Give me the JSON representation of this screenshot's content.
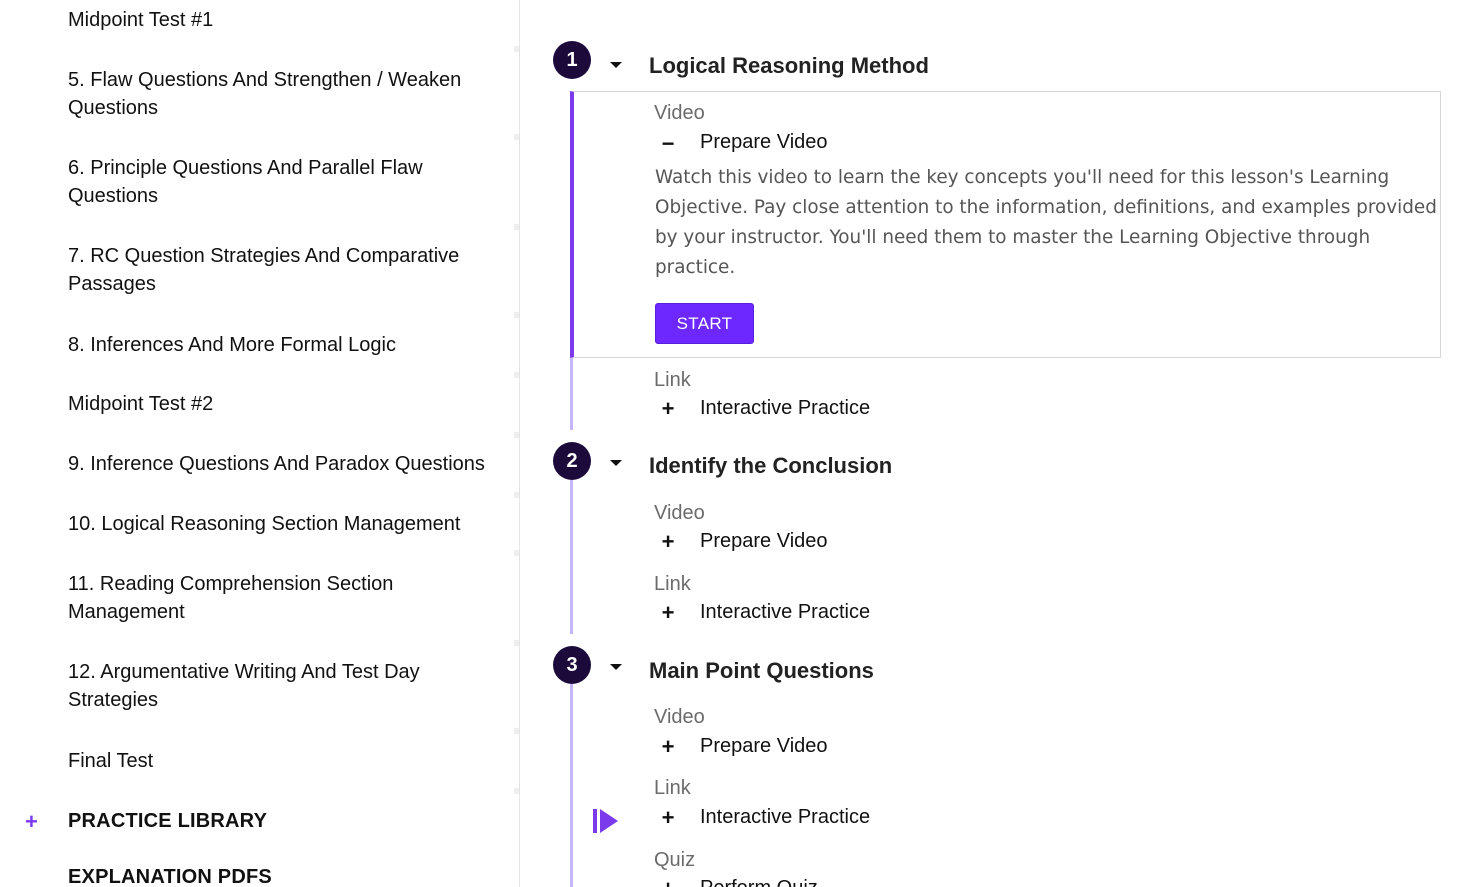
{
  "sidebar": {
    "items": [
      {
        "label": "Midpoint Test #1"
      },
      {
        "label": "5. Flaw Questions And Strengthen / Weaken Questions"
      },
      {
        "label": "6. Principle Questions And Parallel Flaw Questions"
      },
      {
        "label": "7. RC Question Strategies And Comparative Passages"
      },
      {
        "label": "8. Inferences And More Formal Logic"
      },
      {
        "label": "Midpoint Test #2"
      },
      {
        "label": "9. Inference Questions And Paradox Questions"
      },
      {
        "label": "10. Logical Reasoning Section Management"
      },
      {
        "label": "11. Reading Comprehension Section Management"
      },
      {
        "label": "12. Argumentative Writing And Test Day Strategies"
      },
      {
        "label": "Final Test"
      }
    ],
    "sections": [
      {
        "label": "PRACTICE LIBRARY",
        "toggle": "+"
      },
      {
        "label": "EXPLANATION PDFS"
      }
    ]
  },
  "lessons": [
    {
      "number": "1",
      "title": "Logical Reasoning Method",
      "items": [
        {
          "type": "Video",
          "toggle": "−",
          "title": "Prepare Video",
          "description": "Watch this video to learn the key concepts you'll need for this lesson's Learning Objective. Pay close attention to the information, definitions, and examples provided by your instructor. You'll need them to master the Learning Objective through practice.",
          "button": "START"
        },
        {
          "type": "Link",
          "toggle": "+",
          "title": "Interactive Practice"
        }
      ]
    },
    {
      "number": "2",
      "title": "Identify the Conclusion",
      "items": [
        {
          "type": "Video",
          "toggle": "+",
          "title": "Prepare Video"
        },
        {
          "type": "Link",
          "toggle": "+",
          "title": "Interactive Practice"
        }
      ]
    },
    {
      "number": "3",
      "title": "Main Point Questions",
      "items": [
        {
          "type": "Video",
          "toggle": "+",
          "title": "Prepare Video"
        },
        {
          "type": "Link",
          "toggle": "+",
          "title": "Interactive Practice"
        },
        {
          "type": "Quiz",
          "toggle": "+",
          "title": "Perform Quiz"
        }
      ]
    }
  ],
  "icons": {
    "current_item": "play-bar-icon",
    "expand_caret": "caret-down-icon"
  },
  "colors": {
    "accent": "#7c3aed",
    "button": "#6d28ff",
    "timeline": "#c4b5fd",
    "lesson_badge": "#1b0a3a"
  }
}
